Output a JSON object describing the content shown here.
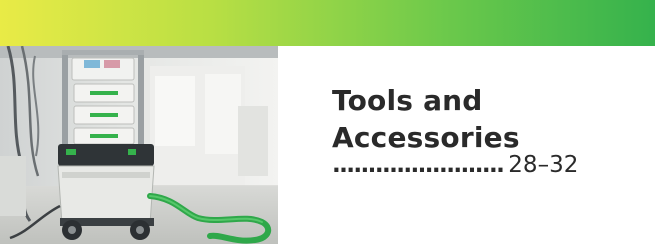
{
  "header": {
    "gradient_colors": [
      "#e9eb46",
      "#b9df44",
      "#6cc94b",
      "#35b24c"
    ]
  },
  "photo": {
    "subject": "mobile dust extractor with hose in workshop",
    "accent_color": "#35b24c"
  },
  "section": {
    "title_line1": "Tools and",
    "title_line2": "Accessories",
    "leader_dots": "........................",
    "page_range": "28–32"
  }
}
